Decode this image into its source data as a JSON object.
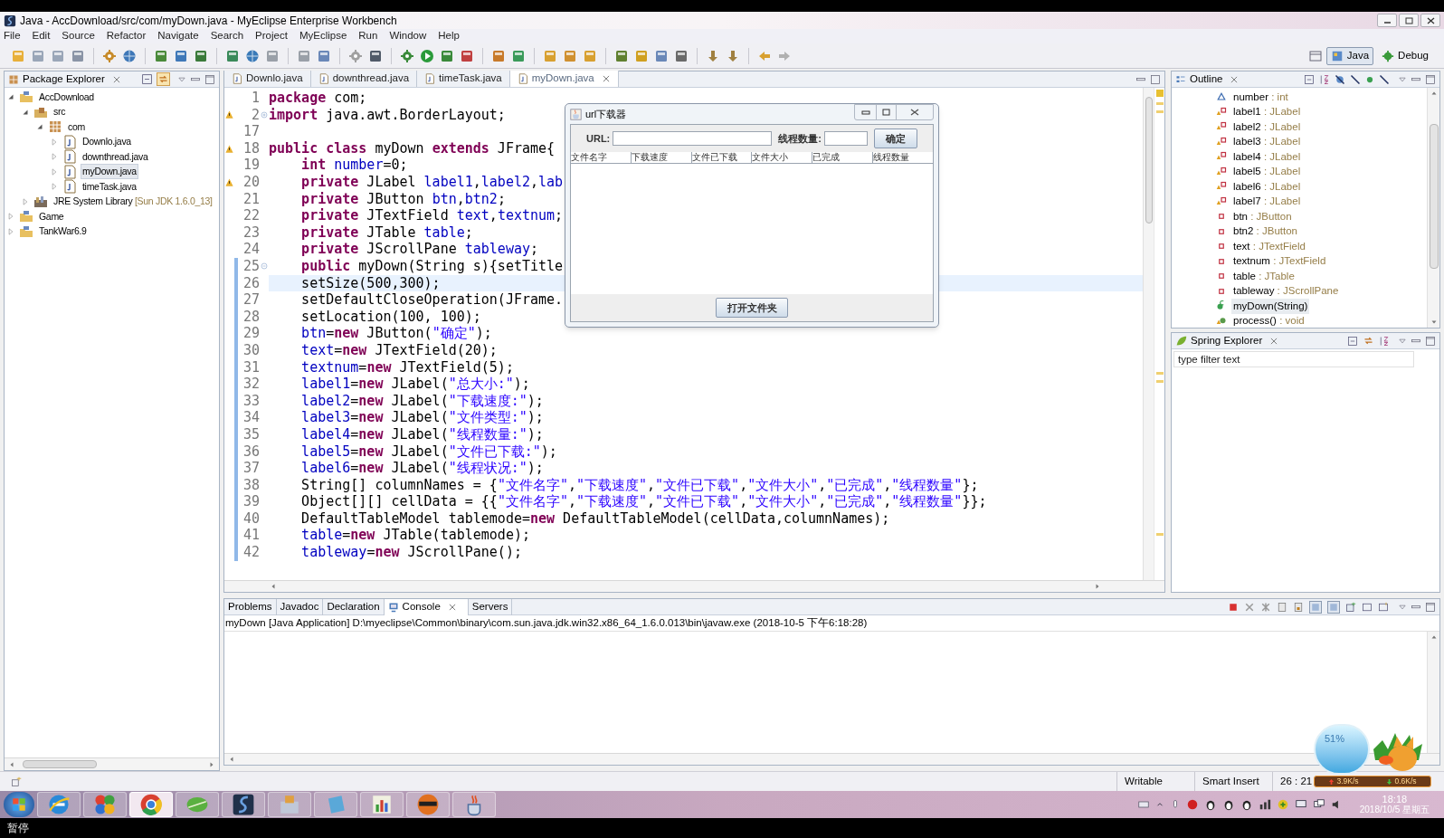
{
  "window": {
    "title": "Java - AccDownload/src/com/myDown.java - MyEclipse Enterprise Workbench"
  },
  "menu": [
    "File",
    "Edit",
    "Source",
    "Refactor",
    "Navigate",
    "Search",
    "Project",
    "MyEclipse",
    "Run",
    "Window",
    "Help"
  ],
  "perspectives": [
    {
      "label": "Java",
      "selected": true
    },
    {
      "label": "Debug",
      "selected": false
    }
  ],
  "package_explorer": {
    "title": "Package Explorer",
    "tree": [
      {
        "label": "AccDownload",
        "kind": "project",
        "expanded": true,
        "selected": false,
        "children": [
          {
            "label": "src",
            "kind": "source",
            "expanded": true,
            "selected": false,
            "children": [
              {
                "label": "com",
                "kind": "package",
                "expanded": true,
                "selected": false,
                "children": [
                  {
                    "label": "Downlo.java",
                    "kind": "java",
                    "expanded": false,
                    "selected": false
                  },
                  {
                    "label": "downthread.java",
                    "kind": "java",
                    "expanded": false,
                    "selected": false
                  },
                  {
                    "label": "myDown.java",
                    "kind": "java",
                    "expanded": false,
                    "selected": true
                  },
                  {
                    "label": "timeTask.java",
                    "kind": "java",
                    "expanded": false,
                    "selected": false
                  }
                ]
              }
            ]
          },
          {
            "label": "JRE System Library",
            "decoration": "[Sun JDK 1.6.0_13]",
            "kind": "library",
            "expanded": false,
            "selected": false
          }
        ]
      },
      {
        "label": "Game",
        "kind": "project",
        "expanded": false,
        "selected": false
      },
      {
        "label": "TankWar6.9",
        "kind": "project",
        "expanded": false,
        "selected": false
      }
    ]
  },
  "editor": {
    "tabs": [
      {
        "label": "Downlo.java",
        "selected": false
      },
      {
        "label": "downthread.java",
        "selected": false
      },
      {
        "label": "timeTask.java",
        "selected": false
      },
      {
        "label": "myDown.java",
        "selected": true
      }
    ],
    "lines": [
      {
        "n": "1",
        "warning": false,
        "current": false,
        "changed": false,
        "tokens": [
          {
            "kind": "kw",
            "t": "package"
          },
          {
            "kind": "p",
            "t": " com;"
          }
        ]
      },
      {
        "n": "2",
        "warning": true,
        "current": false,
        "changed": false,
        "fold": {
          "kind": "expand"
        },
        "tokens": [
          {
            "kind": "kw",
            "t": "import"
          },
          {
            "kind": "p",
            "t": " java.awt.BorderLayout;"
          }
        ]
      },
      {
        "n": "17",
        "warning": false,
        "current": false,
        "changed": false
      },
      {
        "n": "18",
        "warning": true,
        "current": false,
        "changed": false,
        "tokens": [
          {
            "kind": "kw",
            "t": "public class"
          },
          {
            "kind": "p",
            "t": " myDown "
          },
          {
            "kind": "kw",
            "t": "extends"
          },
          {
            "kind": "p",
            "t": " JFrame{"
          }
        ]
      },
      {
        "n": "19",
        "warning": false,
        "current": false,
        "changed": false,
        "tokens": [
          {
            "kind": "kw",
            "t": "    int"
          },
          {
            "kind": "f",
            "t": " number"
          },
          {
            "kind": "p",
            "t": "=0;"
          }
        ]
      },
      {
        "n": "20",
        "warning": true,
        "current": false,
        "changed": false,
        "tokens": [
          {
            "kind": "kw",
            "t": "    private"
          },
          {
            "kind": "p",
            "t": " JLabel "
          },
          {
            "kind": "f",
            "t": "label1"
          },
          {
            "kind": "p",
            "t": ","
          },
          {
            "kind": "f",
            "t": "label2"
          },
          {
            "kind": "p",
            "t": ","
          },
          {
            "kind": "f",
            "t": "lab"
          }
        ]
      },
      {
        "n": "21",
        "warning": false,
        "current": false,
        "changed": false,
        "tokens": [
          {
            "kind": "kw",
            "t": "    private"
          },
          {
            "kind": "p",
            "t": " JButton "
          },
          {
            "kind": "f",
            "t": "btn"
          },
          {
            "kind": "p",
            "t": ","
          },
          {
            "kind": "f",
            "t": "btn2"
          },
          {
            "kind": "p",
            "t": ";"
          }
        ]
      },
      {
        "n": "22",
        "warning": false,
        "current": false,
        "changed": false,
        "tokens": [
          {
            "kind": "kw",
            "t": "    private"
          },
          {
            "kind": "p",
            "t": " JTextField "
          },
          {
            "kind": "f",
            "t": "text"
          },
          {
            "kind": "p",
            "t": ","
          },
          {
            "kind": "f",
            "t": "textnum"
          },
          {
            "kind": "p",
            "t": ";"
          }
        ]
      },
      {
        "n": "23",
        "warning": false,
        "current": false,
        "changed": false,
        "tokens": [
          {
            "kind": "kw",
            "t": "    private"
          },
          {
            "kind": "p",
            "t": " JTable "
          },
          {
            "kind": "f",
            "t": "table"
          },
          {
            "kind": "p",
            "t": ";"
          }
        ]
      },
      {
        "n": "24",
        "warning": false,
        "current": false,
        "changed": false,
        "tokens": [
          {
            "kind": "kw",
            "t": "    private"
          },
          {
            "kind": "p",
            "t": " JScrollPane "
          },
          {
            "kind": "f",
            "t": "tableway"
          },
          {
            "kind": "p",
            "t": ";"
          }
        ]
      },
      {
        "n": "25",
        "warning": false,
        "current": false,
        "changed": true,
        "fold": {
          "kind": "collapse"
        },
        "tokens": [
          {
            "kind": "kw",
            "t": "    public"
          },
          {
            "kind": "p",
            "t": " myDown(String s){setTitle"
          }
        ]
      },
      {
        "n": "26",
        "warning": false,
        "current": true,
        "changed": true,
        "tokens": [
          {
            "kind": "p",
            "t": "    setSize(500,300);"
          }
        ]
      },
      {
        "n": "27",
        "warning": false,
        "current": false,
        "changed": true,
        "tokens": [
          {
            "kind": "p",
            "t": "    setDefaultCloseOperation(JFrame."
          }
        ]
      },
      {
        "n": "28",
        "warning": false,
        "current": false,
        "changed": true,
        "tokens": [
          {
            "kind": "p",
            "t": "    setLocation(100, 100);"
          }
        ]
      },
      {
        "n": "29",
        "warning": false,
        "current": false,
        "changed": true,
        "tokens": [
          {
            "kind": "f",
            "t": "    btn"
          },
          {
            "kind": "p",
            "t": "="
          },
          {
            "kind": "kw",
            "t": "new"
          },
          {
            "kind": "p",
            "t": " JButton("
          },
          {
            "kind": "s",
            "t": "\"确定\""
          },
          {
            "kind": "p",
            "t": ");"
          }
        ]
      },
      {
        "n": "30",
        "warning": false,
        "current": false,
        "changed": true,
        "tokens": [
          {
            "kind": "f",
            "t": "    text"
          },
          {
            "kind": "p",
            "t": "="
          },
          {
            "kind": "kw",
            "t": "new"
          },
          {
            "kind": "p",
            "t": " JTextField(20);"
          }
        ]
      },
      {
        "n": "31",
        "warning": false,
        "current": false,
        "changed": true,
        "tokens": [
          {
            "kind": "f",
            "t": "    textnum"
          },
          {
            "kind": "p",
            "t": "="
          },
          {
            "kind": "kw",
            "t": "new"
          },
          {
            "kind": "p",
            "t": " JTextField(5);"
          }
        ]
      },
      {
        "n": "32",
        "warning": false,
        "current": false,
        "changed": true,
        "tokens": [
          {
            "kind": "f",
            "t": "    label1"
          },
          {
            "kind": "p",
            "t": "="
          },
          {
            "kind": "kw",
            "t": "new"
          },
          {
            "kind": "p",
            "t": " JLabel("
          },
          {
            "kind": "s",
            "t": "\"总大小:\""
          },
          {
            "kind": "p",
            "t": ");"
          }
        ]
      },
      {
        "n": "33",
        "warning": false,
        "current": false,
        "changed": true,
        "tokens": [
          {
            "kind": "f",
            "t": "    label2"
          },
          {
            "kind": "p",
            "t": "="
          },
          {
            "kind": "kw",
            "t": "new"
          },
          {
            "kind": "p",
            "t": " JLabel("
          },
          {
            "kind": "s",
            "t": "\"下载速度:\""
          },
          {
            "kind": "p",
            "t": ");"
          }
        ]
      },
      {
        "n": "34",
        "warning": false,
        "current": false,
        "changed": true,
        "tokens": [
          {
            "kind": "f",
            "t": "    label3"
          },
          {
            "kind": "p",
            "t": "="
          },
          {
            "kind": "kw",
            "t": "new"
          },
          {
            "kind": "p",
            "t": " JLabel("
          },
          {
            "kind": "s",
            "t": "\"文件类型:\""
          },
          {
            "kind": "p",
            "t": ");"
          }
        ]
      },
      {
        "n": "35",
        "warning": false,
        "current": false,
        "changed": true,
        "tokens": [
          {
            "kind": "f",
            "t": "    label4"
          },
          {
            "kind": "p",
            "t": "="
          },
          {
            "kind": "kw",
            "t": "new"
          },
          {
            "kind": "p",
            "t": " JLabel("
          },
          {
            "kind": "s",
            "t": "\"线程数量:\""
          },
          {
            "kind": "p",
            "t": ");"
          }
        ]
      },
      {
        "n": "36",
        "warning": false,
        "current": false,
        "changed": true,
        "tokens": [
          {
            "kind": "f",
            "t": "    label5"
          },
          {
            "kind": "p",
            "t": "="
          },
          {
            "kind": "kw",
            "t": "new"
          },
          {
            "kind": "p",
            "t": " JLabel("
          },
          {
            "kind": "s",
            "t": "\"文件已下载:\""
          },
          {
            "kind": "p",
            "t": ");"
          }
        ]
      },
      {
        "n": "37",
        "warning": false,
        "current": false,
        "changed": true,
        "tokens": [
          {
            "kind": "f",
            "t": "    label6"
          },
          {
            "kind": "p",
            "t": "="
          },
          {
            "kind": "kw",
            "t": "new"
          },
          {
            "kind": "p",
            "t": " JLabel("
          },
          {
            "kind": "s",
            "t": "\"线程状况:\""
          },
          {
            "kind": "p",
            "t": ");"
          }
        ]
      },
      {
        "n": "38",
        "warning": false,
        "current": false,
        "changed": true,
        "tokens": [
          {
            "kind": "p",
            "t": "    String[] columnNames = {"
          },
          {
            "kind": "s",
            "t": "\"文件名字\""
          },
          {
            "kind": "p",
            "t": ","
          },
          {
            "kind": "s",
            "t": "\"下载速度\""
          },
          {
            "kind": "p",
            "t": ","
          },
          {
            "kind": "s",
            "t": "\"文件已下载\""
          },
          {
            "kind": "p",
            "t": ","
          },
          {
            "kind": "s",
            "t": "\"文件大小\""
          },
          {
            "kind": "p",
            "t": ","
          },
          {
            "kind": "s",
            "t": "\"已完成\""
          },
          {
            "kind": "p",
            "t": ","
          },
          {
            "kind": "s",
            "t": "\"线程数量\""
          },
          {
            "kind": "p",
            "t": "};"
          }
        ]
      },
      {
        "n": "39",
        "warning": false,
        "current": false,
        "changed": true,
        "tokens": [
          {
            "kind": "p",
            "t": "    Object[][] cellData = {{"
          },
          {
            "kind": "s",
            "t": "\"文件名字\""
          },
          {
            "kind": "p",
            "t": ","
          },
          {
            "kind": "s",
            "t": "\"下载速度\""
          },
          {
            "kind": "p",
            "t": ","
          },
          {
            "kind": "s",
            "t": "\"文件已下载\""
          },
          {
            "kind": "p",
            "t": ","
          },
          {
            "kind": "s",
            "t": "\"文件大小\""
          },
          {
            "kind": "p",
            "t": ","
          },
          {
            "kind": "s",
            "t": "\"已完成\""
          },
          {
            "kind": "p",
            "t": ","
          },
          {
            "kind": "s",
            "t": "\"线程数量\""
          },
          {
            "kind": "p",
            "t": "}};"
          }
        ]
      },
      {
        "n": "40",
        "warning": false,
        "current": false,
        "changed": true,
        "tokens": [
          {
            "kind": "p",
            "t": "    DefaultTableModel tablemode="
          },
          {
            "kind": "kw",
            "t": "new"
          },
          {
            "kind": "p",
            "t": " DefaultTableModel(cellData,columnNames);"
          }
        ]
      },
      {
        "n": "41",
        "warning": false,
        "current": false,
        "changed": true,
        "tokens": [
          {
            "kind": "f",
            "t": "    table"
          },
          {
            "kind": "p",
            "t": "="
          },
          {
            "kind": "kw",
            "t": "new"
          },
          {
            "kind": "p",
            "t": " JTable(tablemode);"
          }
        ]
      },
      {
        "n": "42",
        "warning": false,
        "current": false,
        "changed": true,
        "tokens": [
          {
            "kind": "f",
            "t": "    tableway"
          },
          {
            "kind": "p",
            "t": "="
          },
          {
            "kind": "kw",
            "t": "new"
          },
          {
            "kind": "p",
            "t": " JScrollPane();"
          }
        ]
      }
    ]
  },
  "dialog": {
    "title": "url下载器",
    "url_label": "URL:",
    "threads_label": "线程数量:",
    "ok_button": "确定",
    "columns": [
      "文件名字",
      "下载速度",
      "文件已下载",
      "文件大小",
      "已完成",
      "线程数量"
    ],
    "open_folder_button": "打开文件夹"
  },
  "outline": {
    "title": "Outline",
    "items": [
      {
        "name": "number",
        "type": ": int",
        "kind": "field",
        "selected": false
      },
      {
        "name": "label1",
        "type": ": JLabel",
        "kind": "private-warn",
        "selected": false
      },
      {
        "name": "label2",
        "type": ": JLabel",
        "kind": "private-warn",
        "selected": false
      },
      {
        "name": "label3",
        "type": ": JLabel",
        "kind": "private-warn",
        "selected": false
      },
      {
        "name": "label4",
        "type": ": JLabel",
        "kind": "private-warn",
        "selected": false
      },
      {
        "name": "label5",
        "type": ": JLabel",
        "kind": "private-warn",
        "selected": false
      },
      {
        "name": "label6",
        "type": ": JLabel",
        "kind": "private-warn",
        "selected": false
      },
      {
        "name": "label7",
        "type": ": JLabel",
        "kind": "private-warn",
        "selected": false
      },
      {
        "name": "btn",
        "type": ": JButton",
        "kind": "private",
        "selected": false
      },
      {
        "name": "btn2",
        "type": ": JButton",
        "kind": "private",
        "selected": false
      },
      {
        "name": "text",
        "type": ": JTextField",
        "kind": "private",
        "selected": false
      },
      {
        "name": "textnum",
        "type": ": JTextField",
        "kind": "private",
        "selected": false
      },
      {
        "name": "table",
        "type": ": JTable",
        "kind": "private",
        "selected": false
      },
      {
        "name": "tableway",
        "type": ": JScrollPane",
        "kind": "private",
        "selected": false
      },
      {
        "name": "myDown(String)",
        "kind": "constructor",
        "selected": true
      },
      {
        "name": "process()",
        "type": ": void",
        "kind": "method-warn",
        "selected": false
      }
    ]
  },
  "spring_explorer": {
    "title": "Spring Explorer",
    "filter": {
      "placeholder": "type filter text"
    }
  },
  "console": {
    "tabs": [
      {
        "label": "Problems",
        "selected": false
      },
      {
        "label": "Javadoc",
        "selected": false
      },
      {
        "label": "Declaration",
        "selected": false
      },
      {
        "label": "Console",
        "selected": true
      },
      {
        "label": "Servers",
        "selected": false
      }
    ],
    "header": "myDown [Java Application] D:\\myeclipse\\Common\\binary\\com.sun.java.jdk.win32.x86_64_1.6.0.013\\bin\\javaw.exe (2018-10-5 下午6:18:28)"
  },
  "status_bar": [
    "Writable",
    "Smart Insert",
    "26 : 21"
  ],
  "net_widget": {
    "percent": "51%",
    "up": "3.9K/s",
    "down": "0.6K/s"
  },
  "taskbar": {
    "apps": [
      {
        "kind": "ie",
        "selected": false
      },
      {
        "kind": "tiles",
        "selected": false
      },
      {
        "kind": "chrome",
        "selected": true
      },
      {
        "kind": "leaf",
        "selected": false
      },
      {
        "kind": "eclipse",
        "selected": false
      },
      {
        "kind": "tools",
        "selected": false
      },
      {
        "kind": "notebook",
        "selected": false
      },
      {
        "kind": "chart",
        "selected": false
      },
      {
        "kind": "mask",
        "selected": false
      },
      {
        "kind": "java",
        "selected": false
      }
    ],
    "time": "18:18",
    "date": "2018/10/5 星期五"
  },
  "recorder": {
    "status": "暂停"
  }
}
